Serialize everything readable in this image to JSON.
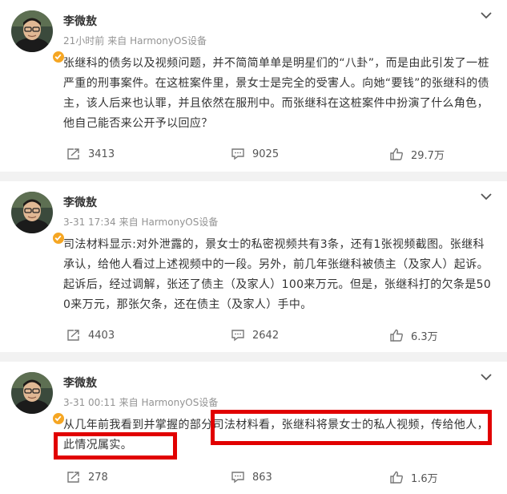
{
  "posts": [
    {
      "author": "李微敖",
      "time": "21小时前",
      "source": "来自 HarmonyOS设备",
      "text": "张继科的债务以及视频问题，并不简简单单是明星们的“八卦”，而是由此引发了一桩严重的刑事案件。在这桩案件里，景女士是完全的受害人。向她“要钱”的张继科的债主，该人后来也认罪，并且依然在服刑中。而张继科在这桩案件中扮演了什么角色，他自己能否来公开予以回应？",
      "shares": "3413",
      "comments": "9025",
      "likes": "29.7万"
    },
    {
      "author": "李微敖",
      "time": "3-31 17:34",
      "source": "来自 HarmonyOS设备",
      "text": "司法材料显示:对外泄露的，景女士的私密视频共有3条，还有1张视频截图。张继科承认，给他人看过上述视频中的一段。另外，前几年张继科被债主（及家人）起诉。起诉后，经过调解，张还了债主（及家人）100来万元。但是，张继科打的欠条是500来万元，那张欠条，还在债主（及家人）手中。",
      "shares": "4403",
      "comments": "2642",
      "likes": "6.3万"
    },
    {
      "author": "李微敖",
      "time": "3-31 00:11",
      "source": "来自 HarmonyOS设备",
      "text": "从几年前我看到并掌握的部分司法材料看，张继科将景女士的私人视频，传给他人，此情况属实。",
      "shares": "278",
      "comments": "863",
      "likes": "1.6万"
    }
  ],
  "icons": {
    "share": "share-icon",
    "comment": "comment-icon",
    "like": "like-icon",
    "more": "chevron-down-icon",
    "verified": "verified-badge-icon"
  },
  "colors": {
    "highlight": "#e10000",
    "badge": "#f5a623",
    "meta_text": "#939393",
    "background": "#f2f2f2"
  }
}
